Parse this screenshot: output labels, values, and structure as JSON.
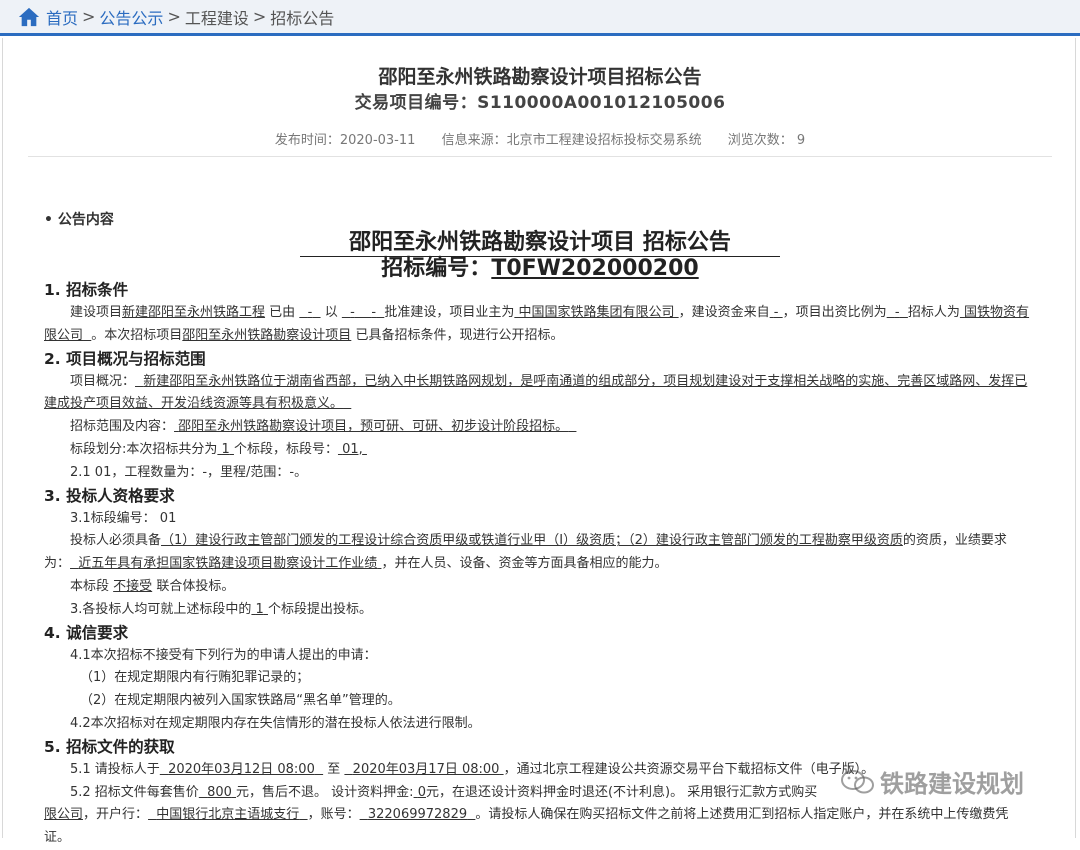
{
  "breadcrumb": {
    "home": "首页",
    "sep1": ">",
    "item1": "公告公示",
    "sep2": ">",
    "item2": "工程建设",
    "sep3": ">",
    "item3": "招标公告"
  },
  "header": {
    "title": "邵阳至永州铁路勘察设计项目招标公告",
    "code_line": "交易项目编号：S110000A001012105006"
  },
  "meta": {
    "date": "发布时间：2020-03-11",
    "source": "信息来源：北京市工程建设招标投标交易系统",
    "views": "浏览次数： 9"
  },
  "section_label": "• 公告内容",
  "doc": {
    "title_line1": "邵阳至永州铁路勘察设计项目 招标公告",
    "title_line2_prefix": "招标编号：",
    "title_line2_code": "T0FW202000200"
  },
  "s1": {
    "heading": "1. 招标条件",
    "a1": "建设项目",
    "a2": "新建邵阳至永州铁路工程",
    "a3": "已由",
    "a4": "-",
    "a5": "以",
    "a6": "-",
    "a7": "-",
    "a8": "批准建设，项目业主为",
    "a9": "中国国家铁路集团有限公司",
    "a10": "，建设资金来自",
    "a11": "-",
    "a12": "，项目出资比例为",
    "a13": "-",
    "a14": "招标人为",
    "a15": "国铁物资有限公司",
    "a16": "。本次招标项目",
    "a17": "邵阳至永州铁路勘察设计项目",
    "a18": "已具备招标条件，现进行公开招标。"
  },
  "s2": {
    "heading": "2. 项目概况与招标范围",
    "b1": "项目概况：",
    "b2": "新建邵阳至永州铁路位于湖南省西部，已纳入中长期铁路网规划，是呼南通道的组成部分，项目规划建设对于支撑相关战略的实施、完善区域路网、发挥已建成投产项目效益、开发沿线资源等具有积极意义。",
    "c1": "招标范围及内容：",
    "c2": "邵阳至永州铁路勘察设计项目，预可研、可研、初步设计阶段招标。",
    "d1": "标段划分:本次招标共分为",
    "d2": "1",
    "d3": "个标段，标段号：",
    "d4": "01,",
    "e1": "2.1 01，工程数量为：-，里程/范围：-。"
  },
  "s3": {
    "heading": "3. 投标人资格要求",
    "f1": "3.1标段编号： 01",
    "g1": "投标人必须具备",
    "g2": "（1）建设行政主管部门颁发的工程设计综合资质甲级或铁道行业甲（Ⅰ）级资质；（2）建设行政主管部门颁发的工程勘察甲级资质",
    "g3": "的资质，业绩要求为：",
    "g4": "近五年具有承担国家铁路建设项目勘察设计工作业绩",
    "g5": "，并在人员、设备、资金等方面具备相应的能力。",
    "h1": "本标段",
    "h2": "不接受",
    "h3": "联合体投标。",
    "i1": "3.各投标人均可就上述标段中的",
    "i2": "1",
    "i3": "个标段提出投标。"
  },
  "s4": {
    "heading": "4. 诚信要求",
    "j1": "4.1本次招标不接受有下列行为的申请人提出的申请：",
    "j2": "（1）在规定期限内有行贿犯罪记录的；",
    "j3": "（2）在规定期限内被列入国家铁路局“黑名单”管理的。",
    "j4": "4.2本次招标对在规定期限内存在失信情形的潜在投标人依法进行限制。"
  },
  "s5": {
    "heading": "5. 招标文件的获取",
    "k1": "5.1 请投标人于",
    "k2": "2020年03月12日 08:00",
    "k3": "至",
    "k4": "2020年03月17日 08:00",
    "k5": "，通过北京工程建设公共资源交易平台下载招标文件（电子版）。",
    "m1": "5.2 招标文件每套售价",
    "m2": "800",
    "m3": "元，售后不退。 设计资料押金:",
    "m4": "0",
    "m5": "元，在退还设计资料押金时退还(不计利息)。 采用银行汇款方式购买",
    "m6": "限公司",
    "m7": "，开户行：",
    "m8": "中国银行北京主语城支行",
    "m9": "，账号：",
    "m10": "322069972829",
    "m11": "。请投标人确保在购买招标文件之前将上述费用汇到招标人指定账户，并在系统中上传缴费凭证。"
  },
  "watermark": "铁路建设规划",
  "colors": {
    "accent": "#2b6cc0",
    "breadcrumb_bg": "#eef2f7"
  }
}
